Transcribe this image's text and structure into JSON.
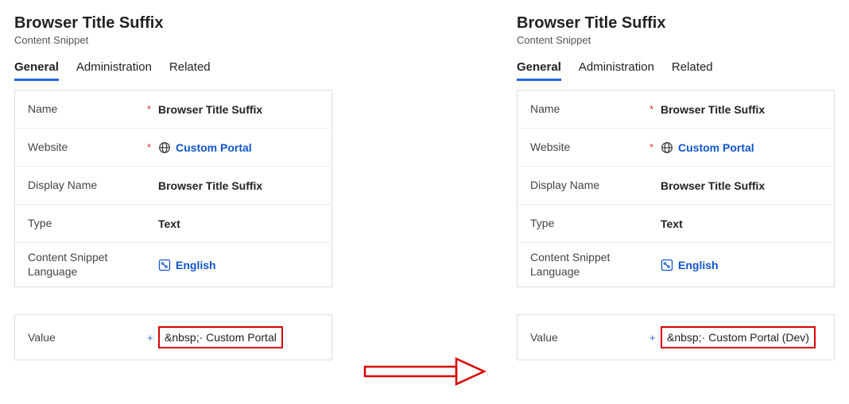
{
  "left": {
    "title": "Browser Title Suffix",
    "subtitle": "Content Snippet",
    "tabs": {
      "general": "General",
      "administration": "Administration",
      "related": "Related"
    },
    "fields": {
      "name_label": "Name",
      "name_value": "Browser Title Suffix",
      "website_label": "Website",
      "website_value": "Custom Portal",
      "display_name_label": "Display Name",
      "display_name_value": "Browser Title Suffix",
      "type_label": "Type",
      "type_value": "Text",
      "lang_label": "Content Snippet Language",
      "lang_value": "English"
    },
    "value_label": "Value",
    "value_text": "&nbsp;· Custom Portal"
  },
  "right": {
    "title": "Browser Title Suffix",
    "subtitle": "Content Snippet",
    "tabs": {
      "general": "General",
      "administration": "Administration",
      "related": "Related"
    },
    "fields": {
      "name_label": "Name",
      "name_value": "Browser Title Suffix",
      "website_label": "Website",
      "website_value": "Custom Portal",
      "display_name_label": "Display Name",
      "display_name_value": "Browser Title Suffix",
      "type_label": "Type",
      "type_value": "Text",
      "lang_label": "Content Snippet Language",
      "lang_value": "English"
    },
    "value_label": "Value",
    "value_text": "&nbsp;· Custom Portal (Dev)"
  },
  "marks": {
    "required": "*",
    "add": "+"
  },
  "colors": {
    "accent": "#2266dd",
    "link": "#1156cc",
    "highlight_border": "#d80000"
  }
}
